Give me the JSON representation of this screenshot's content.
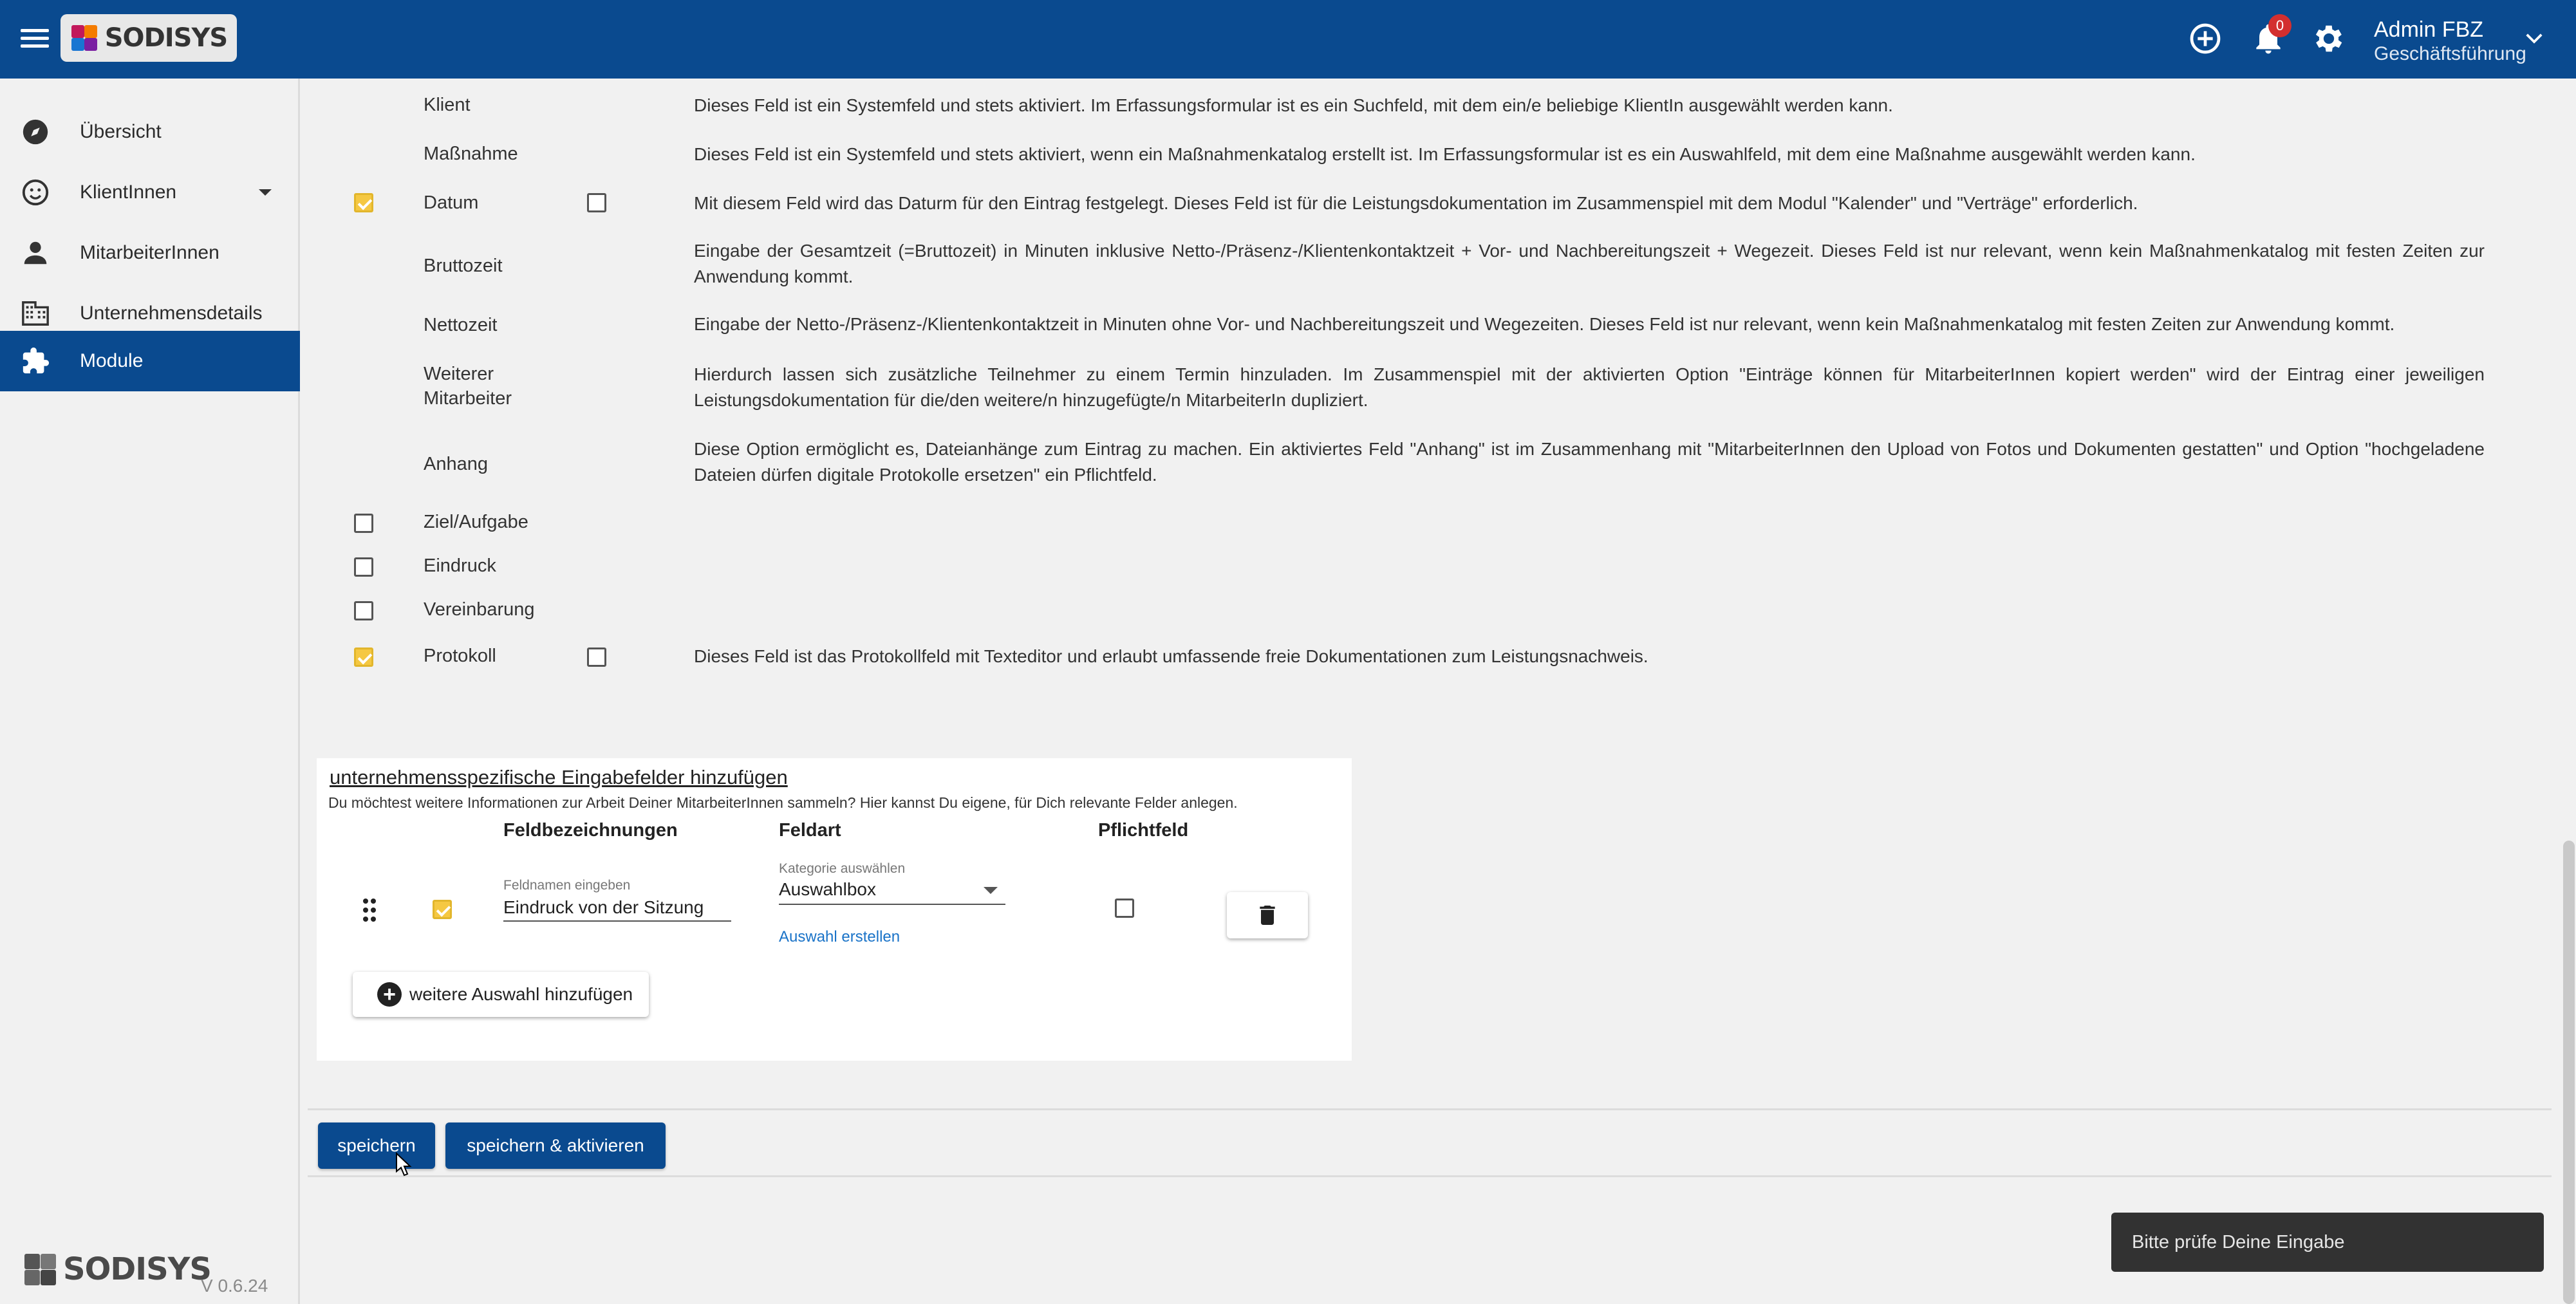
{
  "header": {
    "logo_text": "SODISYS",
    "notification_count": "0",
    "user_name": "Admin FBZ",
    "user_role": "Geschäftsführung",
    "brand_color": "#0a4a8f"
  },
  "sidebar": {
    "items": [
      {
        "label": "Übersicht",
        "icon": "compass-icon"
      },
      {
        "label": "KlientInnen",
        "icon": "smiley-icon"
      },
      {
        "label": "MitarbeiterInnen",
        "icon": "person-icon"
      },
      {
        "label": "Unternehmensdetails",
        "icon": "building-icon"
      },
      {
        "label": "Module",
        "icon": "puzzle-icon",
        "active": true
      }
    ],
    "footer_logo": "SODISYS",
    "version": "V 0.6.24"
  },
  "fields": [
    {
      "name": "Klient",
      "checkbox": "none",
      "required_box": false,
      "desc": "Dieses Feld ist ein Systemfeld und stets aktiviert. Im Erfassungsformular ist es ein Suchfeld, mit dem ein/e beliebige KlientIn ausgewählt werden kann."
    },
    {
      "name": "Maßnahme",
      "checkbox": "none",
      "required_box": false,
      "desc": "Dieses Feld ist ein Systemfeld und stets aktiviert, wenn ein Maßnahmenkatalog erstellt ist. Im Erfassungsformular ist es ein Auswahlfeld, mit dem eine Maßnahme ausgewählt werden kann."
    },
    {
      "name": "Datum",
      "checkbox": "checked",
      "required_box": true,
      "desc": "Mit diesem Feld wird das Daturm für den Eintrag festgelegt. Dieses Feld ist für die Leistungsdokumentation im Zusammenspiel mit dem Modul \"Kalender\" und \"Verträge\" erforderlich."
    },
    {
      "name": "Bruttozeit",
      "checkbox": "none",
      "required_box": false,
      "desc": "Eingabe der Gesamtzeit (=Bruttozeit) in Minuten inklusive Netto-/Präsenz-/Klientenkontaktzeit + Vor- und Nachbereitungszeit + Wegezeit. Dieses Feld ist nur relevant, wenn kein Maßnahmenkatalog mit festen Zeiten zur Anwendung kommt."
    },
    {
      "name": "Nettozeit",
      "checkbox": "none",
      "required_box": false,
      "desc": "Eingabe der Netto-/Präsenz-/Klientenkontaktzeit in Minuten ohne Vor- und Nachbereitungszeit und Wegezeiten. Dieses Feld ist nur relevant, wenn kein Maßnahmenkatalog mit festen Zeiten zur Anwendung kommt."
    },
    {
      "name": "Weiterer Mitarbeiter",
      "checkbox": "none",
      "required_box": false,
      "desc": "Hierdurch lassen sich zusätzliche Teilnehmer zu einem Termin hinzuladen. Im Zusammenspiel mit der aktivierten Option \"Einträge können für MitarbeiterInnen kopiert werden\" wird der Eintrag einer jeweiligen Leistungsdokumentation für die/den weitere/n hinzugefügte/n MitarbeiterIn dupliziert."
    },
    {
      "name": "Anhang",
      "checkbox": "none",
      "required_box": false,
      "desc": "Diese Option ermöglicht es, Dateianhänge zum Eintrag zu machen. Ein aktiviertes Feld \"Anhang\" ist im Zusammenhang mit \"MitarbeiterInnen den Upload von Fotos und Dokumenten gestatten\" und Option \"hochgeladene Dateien dürfen digitale Protokolle ersetzen\" ein Pflichtfeld."
    },
    {
      "name": "Ziel/Aufgabe",
      "checkbox": "unchecked",
      "required_box": false,
      "desc": ""
    },
    {
      "name": "Eindruck",
      "checkbox": "unchecked",
      "required_box": false,
      "desc": ""
    },
    {
      "name": "Vereinbarung",
      "checkbox": "unchecked",
      "required_box": false,
      "desc": ""
    },
    {
      "name": "Protokoll",
      "checkbox": "checked",
      "required_box": true,
      "desc": "Dieses Feld ist das Protokollfeld mit Texteditor und erlaubt umfassende freie Dokumentationen zum Leistungsnachweis."
    }
  ],
  "custom_panel": {
    "title": "unternehmensspezifische Eingabefelder hinzufügen",
    "subtitle": "Du möchtest weitere Informationen zur Arbeit Deiner MitarbeiterInnen sammeln? Hier kannst Du eigene, für Dich relevante Felder anlegen.",
    "col_names": "Feldbezeichnungen",
    "col_type": "Feldart",
    "col_required": "Pflichtfeld",
    "input_label": "Feldnamen eingeben",
    "input_value": "Eindruck von der Sitzung",
    "select_label": "Kategorie auswählen",
    "select_value": "Auswahlbox",
    "link_label": "Auswahl erstellen",
    "add_label": "weitere Auswahl hinzufügen"
  },
  "actions": {
    "save": "speichern",
    "save_activate": "speichern & aktivieren"
  },
  "snackbar": "Bitte prüfe Deine Eingabe",
  "colors": {
    "accent": "#f5c842",
    "primary": "#0a4a8f",
    "link": "#1a73c8"
  }
}
